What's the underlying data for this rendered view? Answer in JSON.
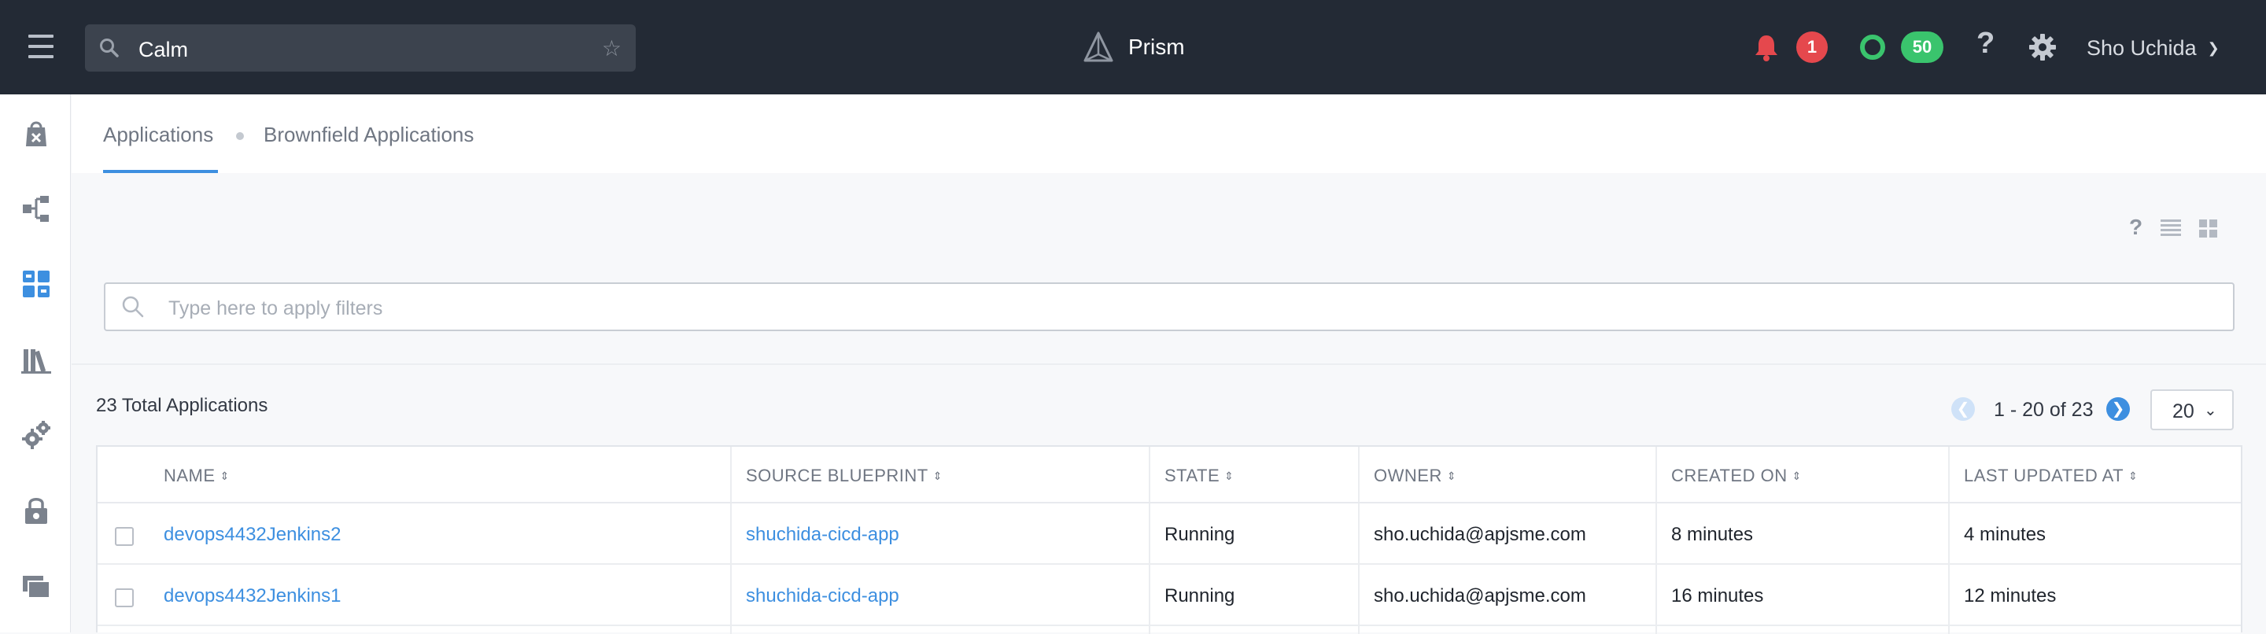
{
  "topbar": {
    "search_value": "Calm",
    "brand": "Prism",
    "alerts_count": "1",
    "tasks_count": "50",
    "help_glyph": "?",
    "user_name": "Sho Uchida"
  },
  "icons": {
    "menu": "hamburger-icon",
    "search": "search-icon",
    "favorite": "star-icon",
    "brand": "prism-logo-icon",
    "alerts": "bell-icon",
    "tasks": "ring-icon",
    "settings": "gear-icon"
  },
  "sidebar": {
    "items": [
      {
        "icon": "marketplace-icon"
      },
      {
        "icon": "blueprints-icon"
      },
      {
        "icon": "applications-icon",
        "active": true
      },
      {
        "icon": "library-icon"
      },
      {
        "icon": "settings-gears-icon"
      },
      {
        "icon": "policies-icon"
      },
      {
        "icon": "projects-icon"
      }
    ]
  },
  "tabs": [
    {
      "label": "Applications",
      "active": true
    },
    {
      "label": "Brownfield Applications",
      "active": false
    }
  ],
  "filter": {
    "placeholder": "Type here to apply filters"
  },
  "summary": {
    "total_label": "23 Total Applications"
  },
  "pagination": {
    "range": "1 - 20 of 23",
    "page_size": "20"
  },
  "table": {
    "columns": [
      "NAME",
      "SOURCE BLUEPRINT",
      "STATE",
      "OWNER",
      "CREATED ON",
      "LAST UPDATED AT"
    ],
    "rows": [
      {
        "name": "devops4432Jenkins2",
        "blueprint": "shuchida-cicd-app",
        "state": "Running",
        "owner": "sho.uchida@apjsme.com",
        "created": "8 minutes",
        "updated": "4 minutes"
      },
      {
        "name": "devops4432Jenkins1",
        "blueprint": "shuchida-cicd-app",
        "state": "Running",
        "owner": "sho.uchida@apjsme.com",
        "created": "16 minutes",
        "updated": "12 minutes"
      }
    ]
  },
  "colors": {
    "topbar_bg": "#232a35",
    "accent": "#3d8fe0",
    "alert_red": "#e5484d",
    "task_green": "#3ac46d"
  }
}
